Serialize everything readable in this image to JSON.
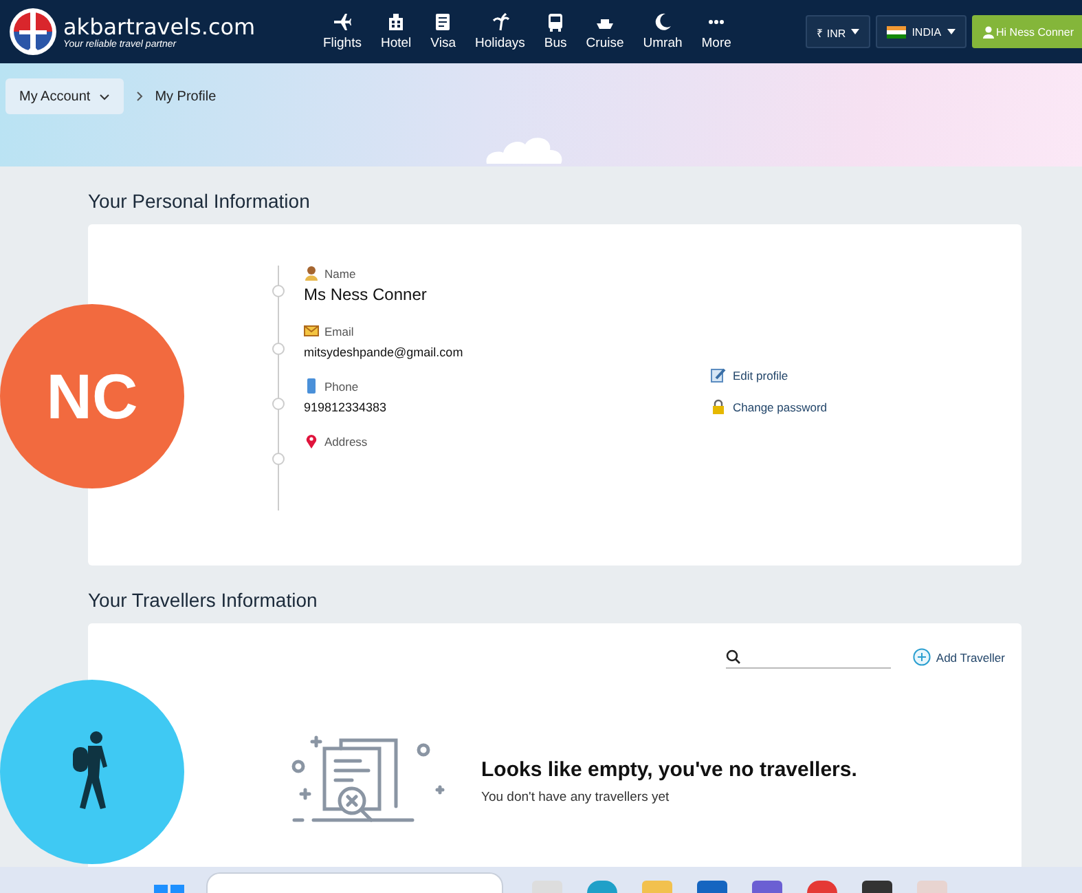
{
  "header": {
    "logo": "akbartravels.com",
    "tagline": "Your reliable travel partner",
    "nav": [
      {
        "kind": "flights",
        "label": "Flights"
      },
      {
        "kind": "hotel",
        "label": "Hotel"
      },
      {
        "kind": "visa",
        "label": "Visa"
      },
      {
        "kind": "holidays",
        "label": "Holidays"
      },
      {
        "kind": "bus",
        "label": "Bus"
      },
      {
        "kind": "cruise",
        "label": "Cruise"
      },
      {
        "kind": "umrah",
        "label": "Umrah"
      },
      {
        "kind": "more",
        "label": "More"
      }
    ],
    "currency": "₹ INR",
    "country": "INDIA",
    "user": "Hi Ness Conner"
  },
  "breadcrumb": {
    "parent": "My Account",
    "current": "My Profile"
  },
  "personal": {
    "heading": "Your Personal Information",
    "initials": "NC",
    "fields": [
      {
        "kind": "name",
        "label": "Name",
        "value": "Ms Ness Conner"
      },
      {
        "kind": "email",
        "label": "Email",
        "value": "mitsydeshpande@gmail.com"
      },
      {
        "kind": "phone",
        "label": "Phone",
        "value": "919812334383"
      },
      {
        "kind": "address",
        "label": "Address"
      }
    ],
    "actions": [
      {
        "kind": "edit",
        "label": "Edit profile"
      },
      {
        "kind": "password",
        "label": "Change password"
      }
    ]
  },
  "travellers": {
    "heading": "Your Travellers Information",
    "add": "Add Traveller",
    "empty_title": "Looks like empty, you've no travellers.",
    "empty_subtitle": "You don't have any travellers yet"
  }
}
